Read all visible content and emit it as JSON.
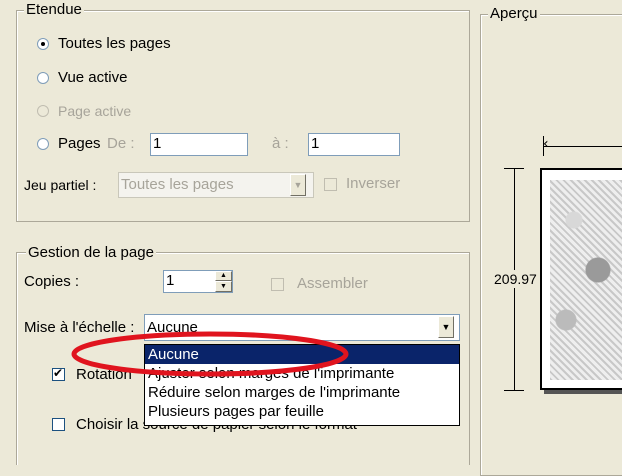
{
  "range": {
    "legend": "Etendue",
    "all_pages": "Toutes les pages",
    "active_view": "Vue active",
    "active_page": "Page active",
    "pages": "Pages",
    "from_label": "De :",
    "from_value": "1",
    "to_label": "à :",
    "to_value": "1",
    "subset_label": "Jeu partiel :",
    "subset_value": "Toutes les pages",
    "reverse": "Inverser"
  },
  "page_handling": {
    "legend": "Gestion de la page",
    "copies_label": "Copies :",
    "copies_value": "1",
    "collate": "Assembler",
    "scaling_label": "Mise à l'échelle :",
    "scaling_value": "Aucune",
    "rotate_label": "Rotation",
    "paper_source_label": "Choisir la source de papier selon le format"
  },
  "dropdown_options": [
    "Aucune",
    "Ajuster selon marges de l'imprimante",
    "Réduire selon marges de l'imprimante",
    "Plusieurs pages par feuille"
  ],
  "preview": {
    "legend": "Aperçu",
    "height_value": "209.97"
  },
  "annotation": {
    "color": "#e0141e"
  }
}
